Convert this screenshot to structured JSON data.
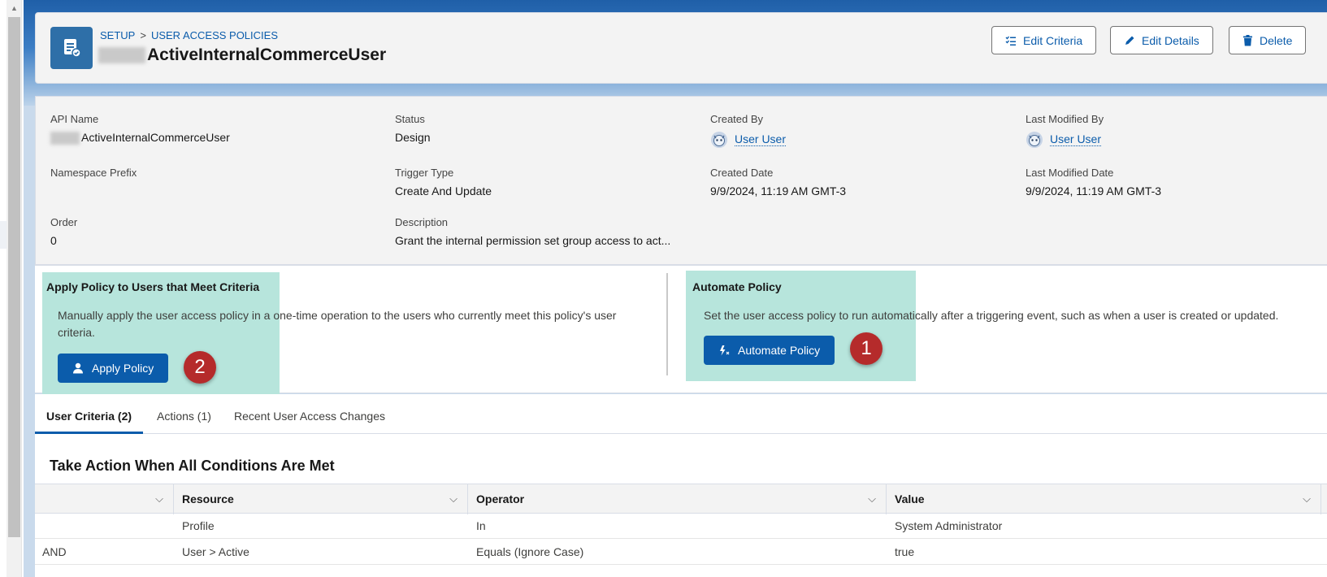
{
  "breadcrumb": {
    "root": "SETUP",
    "separator": ">",
    "section": "USER ACCESS POLICIES"
  },
  "record": {
    "title": "ActiveInternalCommerceUser"
  },
  "actions": {
    "edit_criteria": "Edit Criteria",
    "edit_details": "Edit Details",
    "delete": "Delete"
  },
  "details": {
    "api_name": {
      "label": "API Name",
      "value": "ActiveInternalCommerceUser"
    },
    "status": {
      "label": "Status",
      "value": "Design"
    },
    "created_by": {
      "label": "Created By",
      "value": "User User"
    },
    "last_modified_by": {
      "label": "Last Modified By",
      "value": "User User"
    },
    "namespace_prefix": {
      "label": "Namespace Prefix",
      "value": ""
    },
    "trigger_type": {
      "label": "Trigger Type",
      "value": "Create And Update"
    },
    "created_date": {
      "label": "Created Date",
      "value": "9/9/2024, 11:19 AM GMT-3"
    },
    "last_modified_date": {
      "label": "Last Modified Date",
      "value": "9/9/2024, 11:19 AM GMT-3"
    },
    "order": {
      "label": "Order",
      "value": "0"
    },
    "description": {
      "label": "Description",
      "value": "Grant the internal permission set group access to act..."
    }
  },
  "apply_section": {
    "title": "Apply Policy to Users that Meet Criteria",
    "text_line1": "Manually apply the user access policy in a one-time operation to the users who currently meet this policy's user",
    "text_line2": "criteria.",
    "button": "Apply Policy",
    "marker": "2"
  },
  "automate_section": {
    "title": "Automate Policy",
    "text": "Set the user access policy to run automatically after a triggering event, such as when a user is created or updated.",
    "button": "Automate Policy",
    "marker": "1"
  },
  "tabs": [
    {
      "label": "User Criteria (2)",
      "active": true
    },
    {
      "label": "Actions (1)",
      "active": false
    },
    {
      "label": "Recent User Access Changes",
      "active": false
    }
  ],
  "conditions": {
    "title": "Take Action When All Conditions Are Met",
    "columns": [
      "",
      "Resource",
      "Operator",
      "Value"
    ],
    "rows": [
      {
        "logic": "",
        "resource": "Profile",
        "operator": "In",
        "value": "System Administrator"
      },
      {
        "logic": "AND",
        "resource": "User > Active",
        "operator": "Equals (Ignore Case)",
        "value": "true"
      }
    ]
  },
  "colors": {
    "brand": "#0b5cab",
    "highlight": "#b7e5dc",
    "marker": "#b52b2b"
  }
}
